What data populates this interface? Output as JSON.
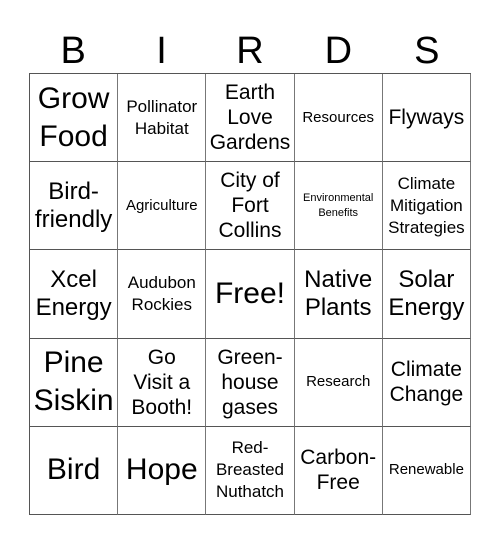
{
  "title_letters": [
    "B",
    "I",
    "R",
    "D",
    "S"
  ],
  "grid": [
    [
      {
        "text": "Grow\nFood",
        "size": "s-xl"
      },
      {
        "text": "Pollinator\nHabitat",
        "size": "s-s"
      },
      {
        "text": "Earth\nLove\nGardens",
        "size": "s-m"
      },
      {
        "text": "Resources",
        "size": "s-xs"
      },
      {
        "text": "Flyways",
        "size": "s-m"
      }
    ],
    [
      {
        "text": "Bird-\nfriendly",
        "size": "s-l"
      },
      {
        "text": "Agriculture",
        "size": "s-xs"
      },
      {
        "text": "City of\nFort\nCollins",
        "size": "s-m"
      },
      {
        "text": "Environmental\nBenefits",
        "size": "s-xxs"
      },
      {
        "text": "Climate\nMitigation\nStrategies",
        "size": "s-s"
      }
    ],
    [
      {
        "text": "Xcel\nEnergy",
        "size": "s-l"
      },
      {
        "text": "Audubon\nRockies",
        "size": "s-s"
      },
      {
        "text": "Free!",
        "size": "s-xl"
      },
      {
        "text": "Native\nPlants",
        "size": "s-l"
      },
      {
        "text": "Solar\nEnergy",
        "size": "s-l"
      }
    ],
    [
      {
        "text": "Pine\nSiskin",
        "size": "s-xl"
      },
      {
        "text": "Go\nVisit a\nBooth!",
        "size": "s-m"
      },
      {
        "text": "Green-\nhouse\ngases",
        "size": "s-m"
      },
      {
        "text": "Research",
        "size": "s-xs"
      },
      {
        "text": "Climate\nChange",
        "size": "s-m"
      }
    ],
    [
      {
        "text": "Bird",
        "size": "s-xl"
      },
      {
        "text": "Hope",
        "size": "s-xl"
      },
      {
        "text": "Red-\nBreasted\nNuthatch",
        "size": "s-s"
      },
      {
        "text": "Carbon-\nFree",
        "size": "s-m"
      },
      {
        "text": "Renewable",
        "size": "s-xs"
      }
    ]
  ]
}
